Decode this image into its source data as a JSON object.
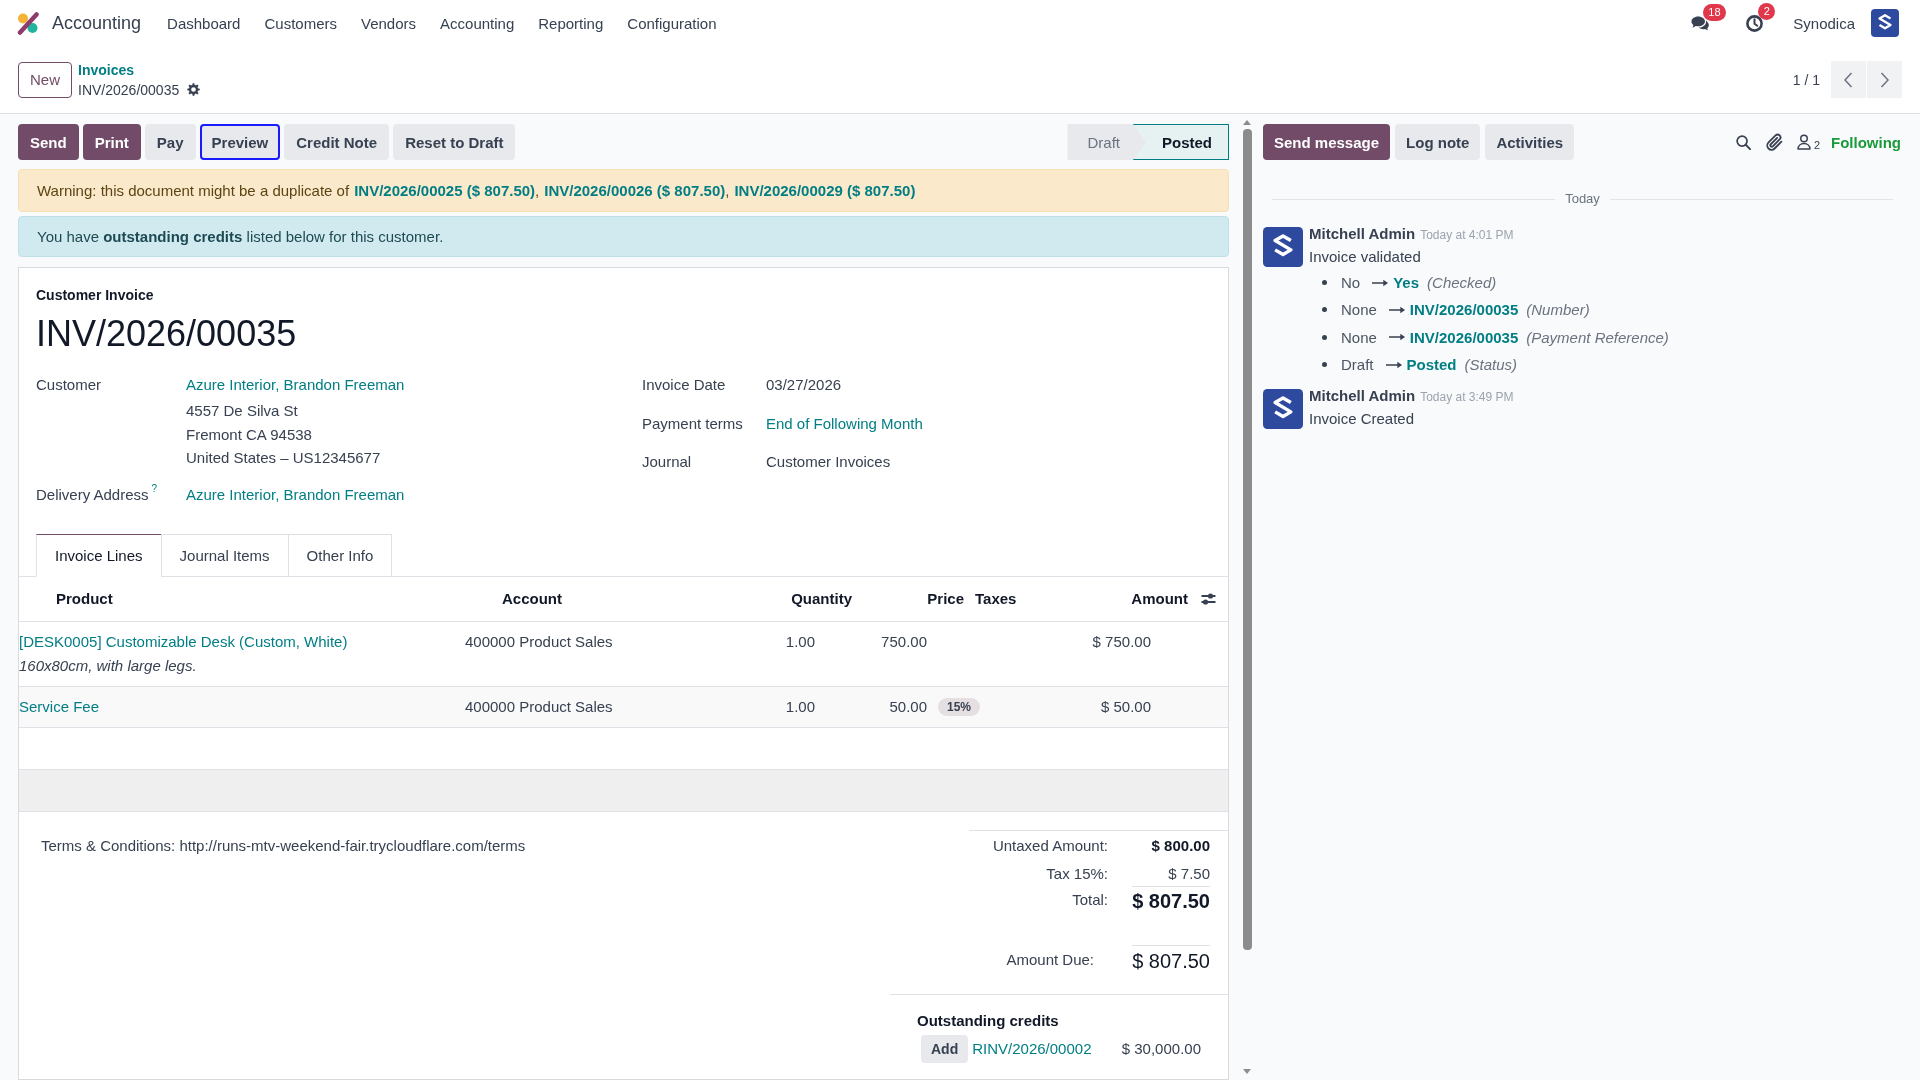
{
  "navbar": {
    "app_name": "Accounting",
    "menu": [
      "Dashboard",
      "Customers",
      "Vendors",
      "Accounting",
      "Reporting",
      "Configuration"
    ],
    "messages_badge": "18",
    "activities_badge": "2",
    "company": "Synodica"
  },
  "breadcrumb": {
    "new_button": "New",
    "parent": "Invoices",
    "current": "INV/2026/00035"
  },
  "pager": "1 / 1",
  "actions": [
    {
      "label": "Send",
      "kind": "primary",
      "focused": false
    },
    {
      "label": "Print",
      "kind": "primary",
      "focused": false
    },
    {
      "label": "Pay",
      "kind": "secondary",
      "focused": false
    },
    {
      "label": "Preview",
      "kind": "secondary",
      "focused": true
    },
    {
      "label": "Credit Note",
      "kind": "secondary",
      "focused": false
    },
    {
      "label": "Reset to Draft",
      "kind": "secondary",
      "focused": false
    }
  ],
  "status_bar": [
    {
      "label": "Draft",
      "selected": false
    },
    {
      "label": "Posted",
      "selected": true
    }
  ],
  "alerts": [
    {
      "kind": "warning",
      "parts": [
        {
          "kind": "text",
          "text": "Warning: this document might be a duplicate of"
        },
        {
          "kind": "link",
          "text": "INV/2026/00025 ($ 807.50)"
        },
        {
          "kind": "text",
          "text": ","
        },
        {
          "kind": "link",
          "text": "INV/2026/00026 ($ 807.50)"
        },
        {
          "kind": "text",
          "text": ","
        },
        {
          "kind": "link",
          "text": "INV/2026/00029 ($ 807.50)"
        }
      ]
    },
    {
      "kind": "info",
      "text": "You have **outstanding credits** listed below for this customer."
    }
  ],
  "invoice": {
    "type_label": "Customer Invoice",
    "number": "INV/2026/00035",
    "left_fields": [
      {
        "label": "Customer",
        "kind": "link",
        "value": "Azure Interior, Brandon Freeman",
        "address": [
          "4557 De Silva St",
          "Fremont CA 94538",
          "United States – US12345677"
        ]
      },
      {
        "label": "Delivery Address",
        "help": "?",
        "kind": "link",
        "value": "Azure Interior, Brandon Freeman"
      }
    ],
    "right_fields": [
      {
        "label": "Invoice Date",
        "kind": "text",
        "value": "03/27/2026"
      },
      {
        "label": "Payment terms",
        "kind": "link",
        "value": "End of Following Month"
      },
      {
        "label": "Journal",
        "kind": "text",
        "value": "Customer Invoices"
      }
    ]
  },
  "tabs": [
    {
      "label": "Invoice Lines",
      "selected": true
    },
    {
      "label": "Journal Items",
      "selected": false
    },
    {
      "label": "Other Info",
      "selected": false
    }
  ],
  "lines": {
    "columns": [
      "Product",
      "Account",
      "Quantity",
      "Price",
      "Taxes",
      "Amount"
    ],
    "rows": [
      {
        "product": "[DESK0005] Customizable Desk (Custom, White)",
        "description": "160x80cm, with large legs.",
        "account": "400000 Product Sales",
        "quantity": "1.00",
        "price": "750.00",
        "amount": "$ 750.00"
      },
      {
        "product": "Service Fee",
        "account": "400000 Product Sales",
        "quantity": "1.00",
        "price": "50.00",
        "taxes": [
          "15%"
        ],
        "amount": "$ 50.00"
      }
    ]
  },
  "terms": "Terms & Conditions: http://runs-mtv-weekend-fair.trycloudflare.com/terms",
  "totals": [
    {
      "label": "Untaxed Amount:",
      "value": "$ 800.00",
      "kind": "untaxed"
    },
    {
      "label": "Tax 15%:",
      "value": "$ 7.50",
      "kind": "tax"
    },
    {
      "label": "Total:",
      "value": "$ 807.50",
      "kind": "total"
    },
    {
      "label": "Amount Due:",
      "value": "$ 807.50",
      "kind": "due"
    }
  ],
  "outstanding_credits": {
    "title": "Outstanding credits",
    "items": [
      {
        "button": "Add",
        "reference": "RINV/2026/00002",
        "amount": "$ 30,000.00"
      }
    ]
  },
  "chatter": {
    "buttons": [
      {
        "label": "Send message",
        "kind": "primary"
      },
      {
        "label": "Log note",
        "kind": "secondary"
      },
      {
        "label": "Activities",
        "kind": "secondary"
      }
    ],
    "followers_count": "2",
    "follow_label": "Following",
    "date_separator": "Today",
    "messages": [
      {
        "author": "Mitchell Admin",
        "time": "Today at 4:01 PM",
        "body": "Invoice validated",
        "changes": [
          {
            "old": "No",
            "new": "Yes",
            "field": "(Checked)"
          },
          {
            "old": "None",
            "new": "INV/2026/00035",
            "field": "(Number)"
          },
          {
            "old": "None",
            "new": "INV/2026/00035",
            "field": "(Payment Reference)"
          },
          {
            "old": "Draft",
            "new": "Posted",
            "field": "(Status)"
          }
        ]
      },
      {
        "author": "Mitchell Admin",
        "time": "Today at 3:49 PM",
        "body": "Invoice Created"
      }
    ]
  }
}
